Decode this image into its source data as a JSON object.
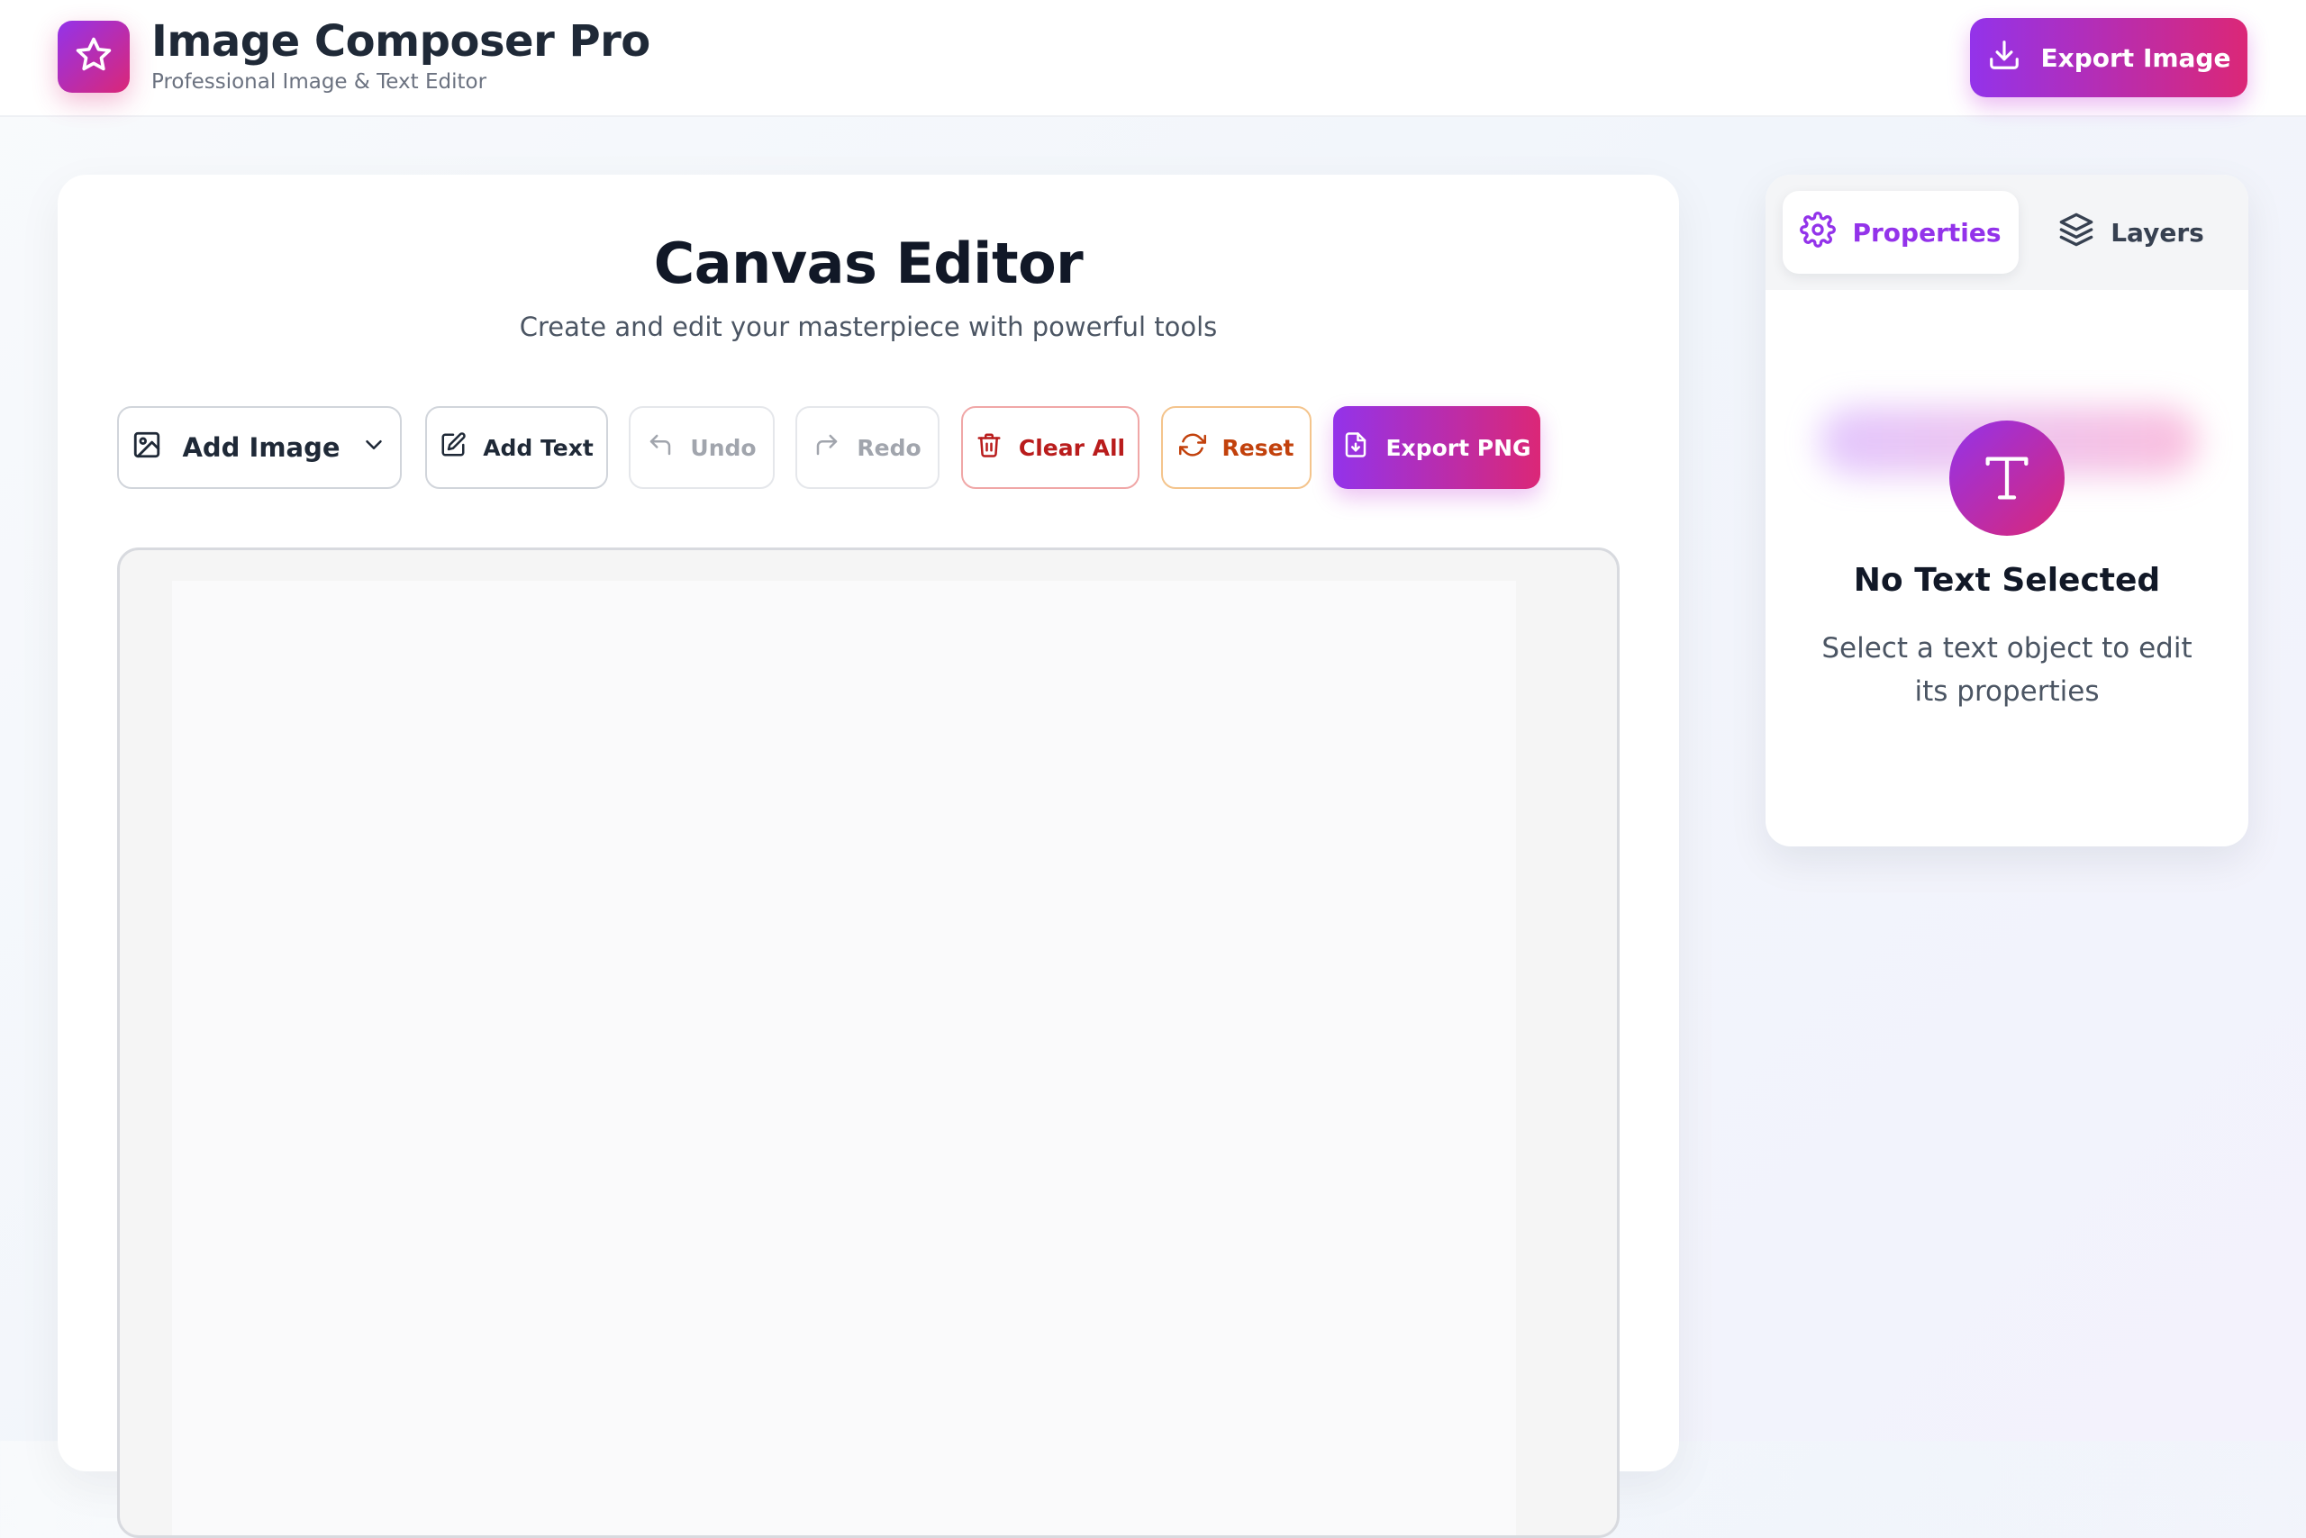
{
  "header": {
    "app_title": "Image Composer Pro",
    "app_subtitle": "Professional Image & Text Editor",
    "logo_icon": "star-icon",
    "export_button_label": "Export Image",
    "export_button_icon": "download-icon"
  },
  "canvas": {
    "title": "Canvas Editor",
    "subtitle": "Create and edit your masterpiece with powerful tools"
  },
  "toolbar": {
    "add_image_label": "Add Image",
    "add_text_label": "Add Text",
    "undo_label": "Undo",
    "redo_label": "Redo",
    "clear_all_label": "Clear All",
    "reset_label": "Reset",
    "export_png_label": "Export PNG"
  },
  "panel": {
    "tabs": [
      {
        "label": "Properties",
        "icon": "gear-icon",
        "active": true
      },
      {
        "label": "Layers",
        "icon": "layers-icon",
        "active": false
      }
    ],
    "empty_state": {
      "icon_letter": "T",
      "title": "No Text Selected",
      "description": "Select a text object to edit its properties"
    }
  },
  "colors": {
    "accent_purple": "#9333ea",
    "accent_pink": "#db2777",
    "danger": "#b91c1c",
    "warning": "#c2410c",
    "disabled_text": "#a1a5ad"
  }
}
